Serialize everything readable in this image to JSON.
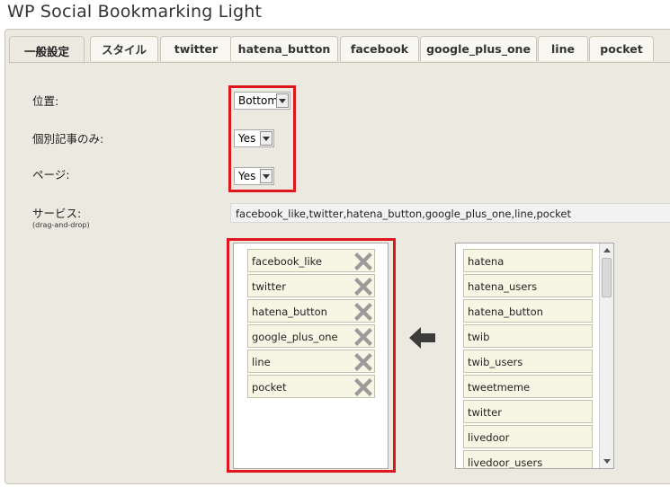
{
  "page": {
    "title": "WP Social Bookmarking Light"
  },
  "tabs": [
    {
      "label": "一般設定"
    },
    {
      "label": "スタイル"
    },
    {
      "label": "twitter"
    },
    {
      "label": "hatena_button"
    },
    {
      "label": "facebook"
    },
    {
      "label": "google_plus_one"
    },
    {
      "label": "line"
    },
    {
      "label": "pocket"
    }
  ],
  "settings": {
    "position_label": "位置:",
    "position_value": "Bottom",
    "single_label": "個別記事のみ:",
    "single_value": "Yes",
    "page_label": "ページ:",
    "page_value": "Yes",
    "services_label": "サービス:",
    "services_hint": "(drag-and-drop)",
    "services_value": "facebook_like,twitter,hatena_button,google_plus_one,line,pocket"
  },
  "selected_services": [
    "facebook_like",
    "twitter",
    "hatena_button",
    "google_plus_one",
    "line",
    "pocket"
  ],
  "available_services": [
    "hatena",
    "hatena_users",
    "hatena_button",
    "twib",
    "twib_users",
    "tweetmeme",
    "twitter",
    "livedoor",
    "livedoor_users"
  ],
  "icons": {
    "remove": "x-icon",
    "move_left": "arrow-left-icon"
  },
  "colors": {
    "highlight": "#e0161e",
    "item_bg": "#f7f6e4",
    "panel_bg": "#eceae0"
  }
}
